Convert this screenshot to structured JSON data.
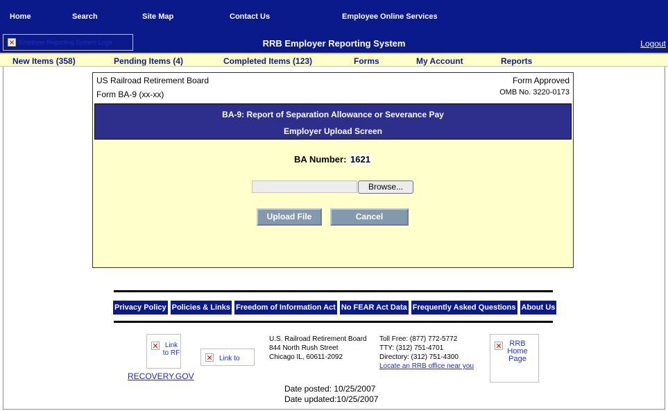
{
  "top_nav": {
    "home": "Home",
    "search": "Search",
    "site_map": "Site Map",
    "contact_us": "Contact Us",
    "employee_online_services": "Employee Online Services"
  },
  "header": {
    "logo_alt": "Employer Reporting System Logo",
    "system_title": "RRB Employer Reporting System",
    "logout": "Logout"
  },
  "menu": {
    "new_items": "New Items (358)",
    "pending_items": "Pending Items (4)",
    "completed_items": "Completed Items (123)",
    "forms": "Forms",
    "my_account": "My Account",
    "reports": "Reports"
  },
  "form": {
    "agency": "US Railroad Retirement Board",
    "form_id": "Form BA-9 (xx-xx)",
    "approval": "Form Approved",
    "omb": "OMB No. 3220-0173",
    "title": "BA-9: Report of Separation Allowance or Severance Pay",
    "subtitle": "Employer Upload Screen",
    "ba_number_label": "BA Number:",
    "ba_number_value": "1621",
    "browse_label": "Browse...",
    "upload_label": "Upload File",
    "cancel_label": "Cancel"
  },
  "footer": {
    "links": [
      "Privacy Policy",
      "Policies & Links",
      "Freedom of Information Act",
      "No FEAR Act Data",
      "Frequently Asked Questions",
      "About Us"
    ],
    "recovery_img_alt": "Link to RF",
    "link_img_alt": "Link to",
    "recovery_link": "RECOVERY.GOV",
    "address_lines": [
      "U.S. Railroad Retirement Board",
      "844 North Rush Street",
      "Chicago IL, 60611-2092"
    ],
    "phone_lines": [
      "Toll Free: (877) 772-5772",
      "TTY: (312) 751-4701",
      "Directory: (312) 751-4300"
    ],
    "office_link": "Locate an RRB office near you",
    "home_img_alt": "RRB Home Page",
    "date_posted": "Date posted: 10/25/2007",
    "date_updated": "Date updated:10/25/2007"
  }
}
